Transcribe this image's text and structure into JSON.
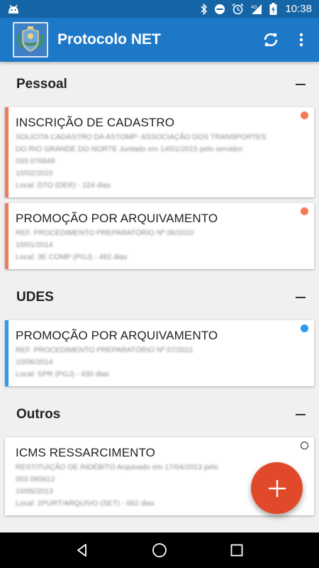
{
  "status_bar": {
    "time": "10:38"
  },
  "app_bar": {
    "title": "Protocolo NET"
  },
  "colors": {
    "primary": "#1e78c8",
    "status_bar": "#1565a6",
    "orange": "#f47b5a",
    "blue": "#2b9af3",
    "fab": "#e04a2b"
  },
  "sections": [
    {
      "title": "Pessoal",
      "cards": [
        {
          "title": "INSCRIÇÃO DE CADASTRO",
          "lines": [
            "SOLICITA CADASTRO DA ASTOMP- ASSOCIAÇÃO DOS TRANSPORTES",
            "DO RIO GRANDE DO NORTE Juntado em 14/01/2015 pelo servidor:",
            "033 076849",
            "10/02/2015",
            "Local: DTO (DER) - 224 dias"
          ]
        },
        {
          "title": "PROMOÇÃO POR ARQUIVAMENTO",
          "lines": [
            "REF. PROCEDIMENTO PREPARATÓRIO Nº 06/2010",
            "10/01/2014",
            "Local: 3E COMP (PGJ) - 482 dias"
          ]
        }
      ]
    },
    {
      "title": "UDES",
      "cards": [
        {
          "title": "PROMOÇÃO POR ARQUIVAMENTO",
          "lines": [
            "REF. PROCEDIMENTO PREPARATÓRIO Nº 07/2011",
            "10/06/2014",
            "Local: SPR (PGJ) - 430 dias"
          ]
        }
      ]
    },
    {
      "title": "Outros",
      "cards": [
        {
          "title": "ICMS RESSARCIMENTO",
          "lines": [
            "RESTITUIÇÃO DE INDÉBITO Arquivado em 17/04/2013 pelo",
            "003 065612",
            "10/05/2013",
            "Local: 2PURT/ARQUIVO (SET) - 662 dias"
          ]
        }
      ]
    }
  ]
}
